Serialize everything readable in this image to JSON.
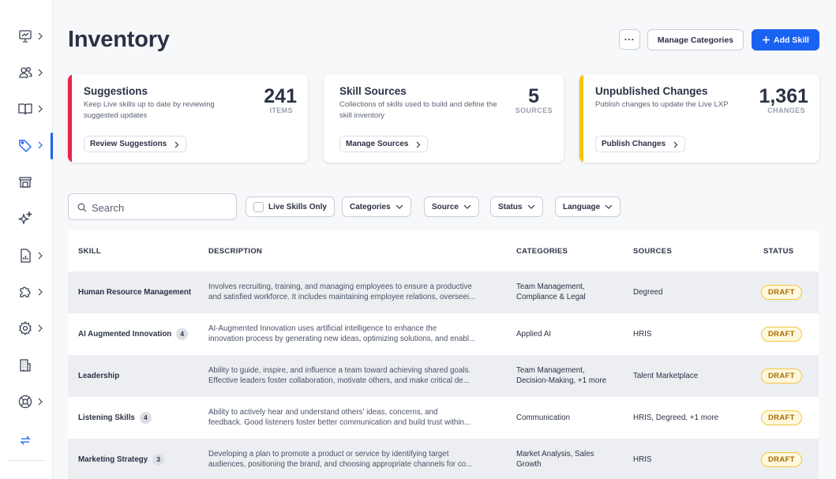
{
  "page": {
    "title": "Inventory"
  },
  "header": {
    "more_label": "···",
    "manage_categories_label": "Manage Categories",
    "add_skill_label": "Add Skill",
    "accent_color": "#1a62f2"
  },
  "sidebar": {
    "items": [
      {
        "icon": "presentation-icon",
        "has_chevron": true
      },
      {
        "icon": "users-icon",
        "has_chevron": true
      },
      {
        "icon": "book-icon",
        "has_chevron": true
      },
      {
        "icon": "tag-icon",
        "has_chevron": true,
        "active": true
      },
      {
        "icon": "store-icon",
        "has_chevron": false
      },
      {
        "icon": "sparkles-icon",
        "has_chevron": false
      },
      {
        "icon": "report-icon",
        "has_chevron": true
      },
      {
        "icon": "puzzle-icon",
        "has_chevron": true
      },
      {
        "icon": "settings-icon",
        "has_chevron": true
      },
      {
        "icon": "building-icon",
        "has_chevron": false
      },
      {
        "icon": "support-icon",
        "has_chevron": true
      },
      {
        "icon": "switch-icon",
        "has_chevron": false
      }
    ]
  },
  "cards": [
    {
      "title": "Suggestions",
      "description": "Keep Live skills up to date by reviewing suggested updates",
      "number": "241",
      "unit": "ITEMS",
      "button": "Review Suggestions",
      "accent": "#e8234a"
    },
    {
      "title": "Skill Sources",
      "description": "Collections of skills used to build and define the skill inventory",
      "number": "5",
      "unit": "SOURCES",
      "button": "Manage Sources",
      "accent": "#ffffff"
    },
    {
      "title": "Unpublished Changes",
      "description": "Publish changes to update the Live LXP",
      "number": "1,361",
      "unit": "CHANGES",
      "button": "Publish Changes",
      "accent": "#f5c400"
    }
  ],
  "filters": {
    "search_placeholder": "Search",
    "live_skills_only": "Live Skills Only",
    "categories": "Categories",
    "source": "Source",
    "status": "Status",
    "language": "Language"
  },
  "table": {
    "headers": {
      "skill": "SKILL",
      "description": "DESCRIPTION",
      "categories": "CATEGORIES",
      "sources": "SOURCES",
      "status": "STATUS"
    },
    "rows": [
      {
        "skill": "Human Resource Management",
        "count": "",
        "description_line1": "Involves recruiting, training, and managing employees to ensure a productive",
        "description_line2": "and satisfied workforce. It includes maintaining employee relations, overseei...",
        "categories_line1": "Team Management,",
        "categories_line2": "Compliance & Legal",
        "sources": "Degreed",
        "status": "DRAFT"
      },
      {
        "skill": "AI Augmented Innovation",
        "count": "4",
        "description_line1": "AI-Augmented Innovation uses artificial intelligence to enhance the",
        "description_line2": "innovation process by generating new ideas, optimizing solutions, and enabl...",
        "categories_line1": "Applied AI",
        "categories_line2": "",
        "sources": "HRIS",
        "status": "DRAFT"
      },
      {
        "skill": "Leadership",
        "count": "",
        "description_line1": "Ability to guide, inspire, and influence a team toward achieving shared goals.",
        "description_line2": "Effective leaders foster collaboration, motivate others, and make critical de...",
        "categories_line1": "Team Management,",
        "categories_line2": "Decision-Making, +1 more",
        "sources": "Talent Marketplace",
        "status": "DRAFT"
      },
      {
        "skill": "Listening Skills",
        "count": "4",
        "description_line1": "Ability to actively hear and understand others' ideas, concerns, and",
        "description_line2": "feedback. Good listeners foster better communication and build trust within...",
        "categories_line1": "Communication",
        "categories_line2": "",
        "sources": "HRIS, Degreed, +1 more",
        "status": "DRAFT"
      },
      {
        "skill": "Marketing Strategy",
        "count": "3",
        "description_line1": "Developing a plan to promote a product or service by identifying target",
        "description_line2": "audiences, positioning the brand, and choosing appropriate channels for co...",
        "categories_line1": "Market Analysis, Sales",
        "categories_line2": "Growth",
        "sources": "HRIS",
        "status": "DRAFT"
      }
    ]
  }
}
